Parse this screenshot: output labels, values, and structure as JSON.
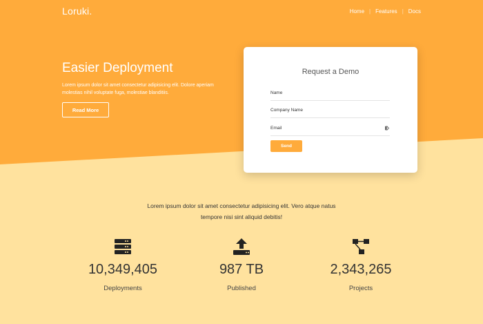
{
  "header": {
    "logo": "Loruki.",
    "nav": [
      "Home",
      "Features",
      "Docs"
    ]
  },
  "hero": {
    "title": "Easier Deployment",
    "text": "Lorem ipsum dolor sit amet consectetur adipisicing elit. Dolore aperiam molestias nihil voluptate fuga, molestiae blanditiis.",
    "button": "Read More"
  },
  "demo_form": {
    "title": "Request a Demo",
    "fields": {
      "name": "Name",
      "company": "Company Name",
      "email": "Email"
    },
    "submit": "Send",
    "icons": {
      "email_field": "password-manager-key-icon"
    }
  },
  "stats": {
    "intro": "Lorem ipsum dolor sit amet consectetur adipisicing elit. Vero atque natus tempore nisi sint aliquid debitis!",
    "items": [
      {
        "icon": "server-icon",
        "value": "10,349,405",
        "label": "Deployments"
      },
      {
        "icon": "upload-icon",
        "value": "987 TB",
        "label": "Published"
      },
      {
        "icon": "project-diagram-icon",
        "value": "2,343,265",
        "label": "Projects"
      }
    ]
  },
  "colors": {
    "primary": "#ffab3b",
    "secondary_bg": "#ffe29e",
    "text_dark": "#333333"
  }
}
